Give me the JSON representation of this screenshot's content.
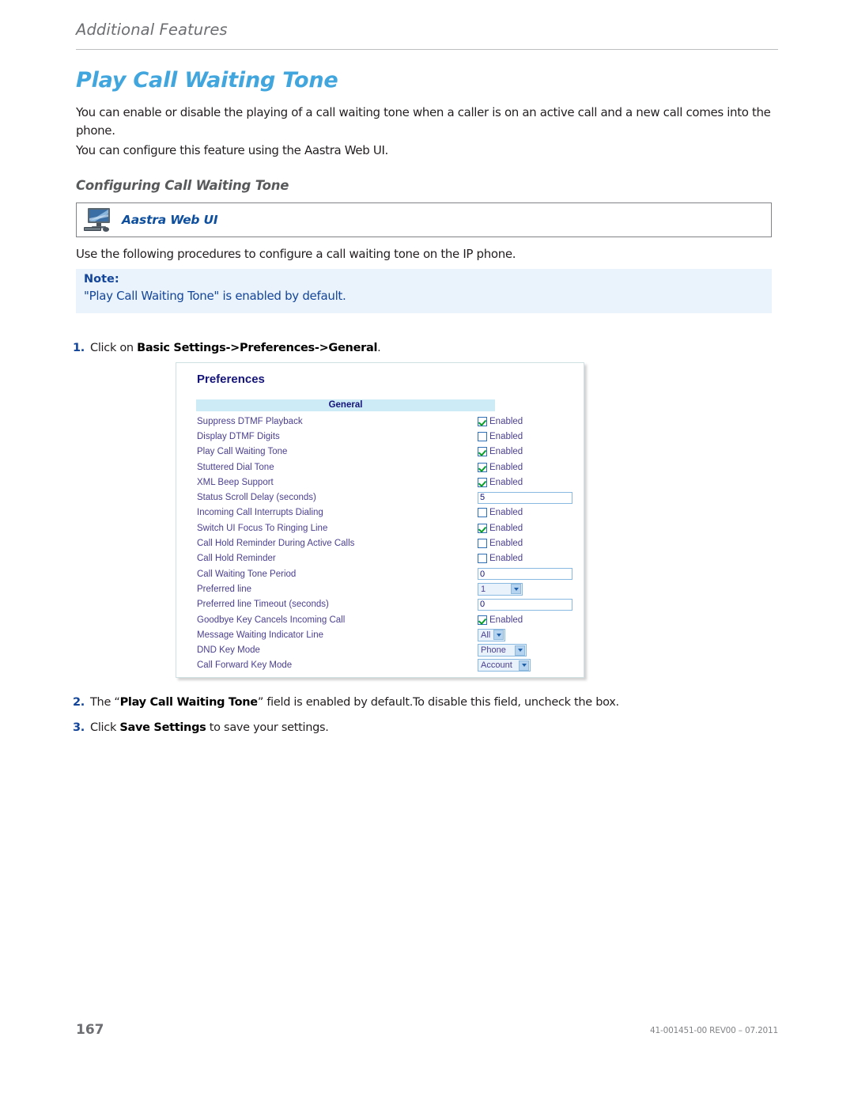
{
  "header": {
    "chapter": "Additional Features"
  },
  "title": "Play Call Waiting Tone",
  "paragraphs": {
    "intro": "You can enable or disable the playing of a call waiting tone when a caller is on an active call and a new call comes into the phone.",
    "configure": "You can configure this feature using the Aastra Web UI.",
    "procedure": "Use the following procedures to configure a call waiting tone on the IP phone."
  },
  "subheading": "Configuring Call Waiting Tone",
  "webui_banner": {
    "icon": "desktop-computer-icon",
    "label": "Aastra Web UI"
  },
  "note": {
    "title": "Note:",
    "text": "\"Play Call Waiting Tone\" is enabled by default."
  },
  "steps": [
    {
      "num": "1.",
      "pre": "Click on ",
      "bold": "Basic Settings->Preferences->General",
      "post": "."
    },
    {
      "num": "2.",
      "pre": "The “",
      "bold": "Play Call Waiting Tone",
      "post": "” field is enabled by default.To disable this field, uncheck the box."
    },
    {
      "num": "3.",
      "pre": "Click ",
      "bold": "Save Settings",
      "post": " to save your settings."
    }
  ],
  "screenshot": {
    "title": "Preferences",
    "section_header": "General",
    "enabled_label": "Enabled",
    "rows": [
      {
        "label": "Suppress DTMF Playback",
        "type": "checkbox",
        "checked": true,
        "value": "Enabled"
      },
      {
        "label": "Display DTMF Digits",
        "type": "checkbox",
        "checked": false,
        "value": "Enabled"
      },
      {
        "label": "Play Call Waiting Tone",
        "type": "checkbox",
        "checked": true,
        "value": "Enabled"
      },
      {
        "label": "Stuttered Dial Tone",
        "type": "checkbox",
        "checked": true,
        "value": "Enabled"
      },
      {
        "label": "XML Beep Support",
        "type": "checkbox",
        "checked": true,
        "value": "Enabled"
      },
      {
        "label": "Status Scroll Delay (seconds)",
        "type": "text",
        "value": "5"
      },
      {
        "label": "Incoming Call Interrupts Dialing",
        "type": "checkbox",
        "checked": false,
        "value": "Enabled"
      },
      {
        "label": "Switch UI Focus To Ringing Line",
        "type": "checkbox",
        "checked": true,
        "value": "Enabled"
      },
      {
        "label": "Call Hold Reminder During Active Calls",
        "type": "checkbox",
        "checked": false,
        "value": "Enabled"
      },
      {
        "label": "Call Hold Reminder",
        "type": "checkbox",
        "checked": false,
        "value": "Enabled"
      },
      {
        "label": "Call Waiting Tone Period",
        "type": "text",
        "value": "0"
      },
      {
        "label": "Preferred line",
        "type": "select",
        "value": "1",
        "width": "w-pref"
      },
      {
        "label": "Preferred line Timeout (seconds)",
        "type": "text",
        "value": "0"
      },
      {
        "label": "Goodbye Key Cancels Incoming Call",
        "type": "checkbox",
        "checked": true,
        "value": "Enabled"
      },
      {
        "label": "Message Waiting Indicator Line",
        "type": "select",
        "value": "All",
        "width": "w-mwi"
      },
      {
        "label": "DND Key Mode",
        "type": "select",
        "value": "Phone",
        "width": "w-dnd"
      },
      {
        "label": "Call Forward Key Mode",
        "type": "select",
        "value": "Account",
        "width": "w-cfk"
      }
    ]
  },
  "footer": {
    "page_number": "167",
    "document_ref": "41-001451-00 REV00 – 07.2011"
  },
  "colors": {
    "title_blue": "#41a6dd",
    "note_blue": "#13459a",
    "note_bg": "#eaf3fb",
    "section_bar": "#cdeaf7",
    "field_label": "#4a3f8f",
    "check_green": "#0a9e28"
  }
}
